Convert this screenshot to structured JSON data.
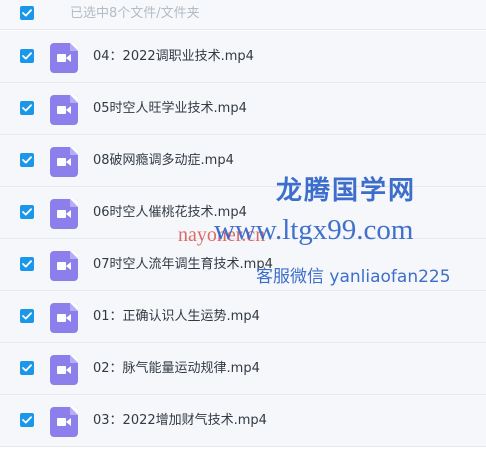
{
  "header": {
    "select_all_checked": true,
    "selection_text": "已选中8个文件/文件夹"
  },
  "files": [
    {
      "name": "04：2022调职业技术.mp4",
      "checked": true,
      "type_icon": "video-file-icon"
    },
    {
      "name": "05时空人旺学业技术.mp4",
      "checked": true,
      "type_icon": "video-file-icon"
    },
    {
      "name": "08破网瘾调多动症.mp4",
      "checked": true,
      "type_icon": "video-file-icon"
    },
    {
      "name": "06时空人催桃花技术.mp4",
      "checked": true,
      "type_icon": "video-file-icon"
    },
    {
      "name": "07时空人流年调生育技术.mp4",
      "checked": true,
      "type_icon": "video-file-icon"
    },
    {
      "name": "01：正确认识人生运势.mp4",
      "checked": true,
      "type_icon": "video-file-icon"
    },
    {
      "name": "02：脉气能量运动规律.mp4",
      "checked": true,
      "type_icon": "video-file-icon"
    },
    {
      "name": "03：2022增加财气技术.mp4",
      "checked": true,
      "type_icon": "video-file-icon"
    }
  ],
  "watermark": {
    "title": "龙腾国学网",
    "url": "www.ltgx99.com",
    "url_overlay": "nayoner.cn",
    "contact": "客服微信 yanliaofan225"
  },
  "colors": {
    "checkbox": "#1a97e8",
    "video_icon": "#8c7fec",
    "row_background": "#f5f7fa",
    "watermark_blue": "#2e63c9",
    "watermark_red": "#d9534f"
  }
}
